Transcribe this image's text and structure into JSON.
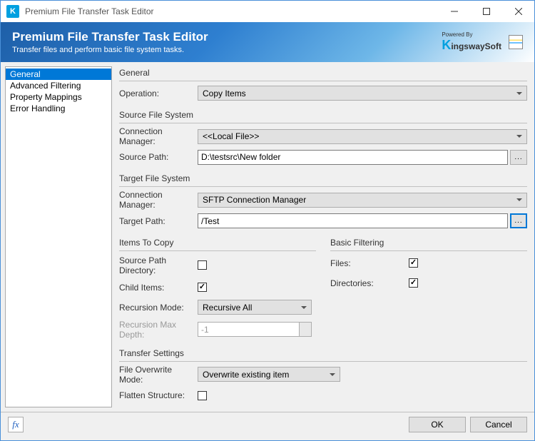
{
  "window": {
    "title": "Premium File Transfer Task Editor"
  },
  "banner": {
    "title": "Premium File Transfer Task Editor",
    "subtitle": "Transfer files and perform basic file system tasks.",
    "powered_by": "Powered By",
    "brand": "ingswaySoft"
  },
  "sidebar": {
    "items": [
      {
        "label": "General",
        "active": true
      },
      {
        "label": "Advanced Filtering",
        "active": false
      },
      {
        "label": "Property Mappings",
        "active": false
      },
      {
        "label": "Error Handling",
        "active": false
      }
    ]
  },
  "sections": {
    "general": "General",
    "source": "Source File System",
    "target": "Target File System",
    "items": "Items To Copy",
    "filtering": "Basic Filtering",
    "transfer": "Transfer Settings"
  },
  "fields": {
    "operation": {
      "label": "Operation:",
      "value": "Copy Items"
    },
    "src_conn": {
      "label": "Connection Manager:",
      "value": "<<Local File>>"
    },
    "src_path": {
      "label": "Source Path:",
      "value": "D:\\testsrc\\New folder"
    },
    "tgt_conn": {
      "label": "Connection Manager:",
      "value": "SFTP Connection Manager"
    },
    "tgt_path": {
      "label": "Target Path:",
      "value": "/Test"
    },
    "src_path_dir": {
      "label": "Source Path Directory:",
      "checked": false
    },
    "child_items": {
      "label": "Child Items:",
      "checked": true
    },
    "recursion_mode": {
      "label": "Recursion Mode:",
      "value": "Recursive All"
    },
    "recursion_depth": {
      "label": "Recursion Max Depth:",
      "value": "-1"
    },
    "files": {
      "label": "Files:",
      "checked": true
    },
    "directories": {
      "label": "Directories:",
      "checked": true
    },
    "overwrite": {
      "label": "File Overwrite Mode:",
      "value": "Overwrite existing item"
    },
    "flatten": {
      "label": "Flatten Structure:",
      "checked": false
    }
  },
  "buttons": {
    "ok": "OK",
    "cancel": "Cancel",
    "browse": "...",
    "fx": "fx"
  }
}
